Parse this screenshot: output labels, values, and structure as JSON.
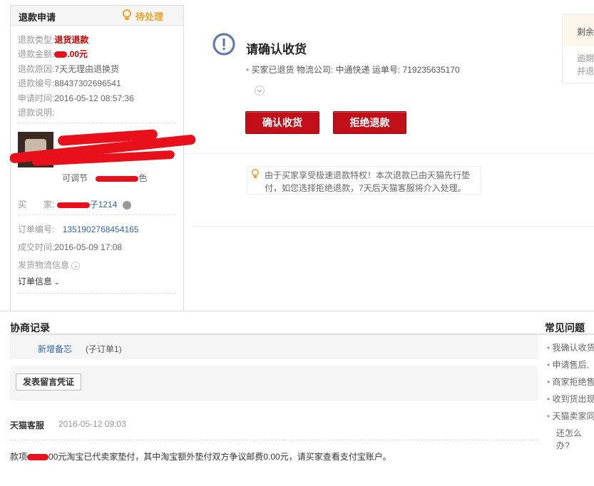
{
  "left": {
    "title": "退款申请",
    "status": "待处理",
    "fields": {
      "type_label": "退款类型:",
      "type_value": "退货退款",
      "amount_label": "退款金额:",
      "amount_value": ".00元",
      "reason_label": "退款原因:",
      "reason_value": "7天无理由退换货",
      "no_label": "退款编号:",
      "no_value": "88437302696541",
      "time_label": "申请时间:",
      "time_value": "2016-05-12 08:57:36",
      "desc_label": "退款说明:"
    },
    "product": {
      "option_label": "可调节",
      "option_suffix": "色"
    },
    "buyer_label": "买　　家:",
    "buyer_value": "子1214",
    "order_label": "订单编号:",
    "order_value": "1351902768454165",
    "deal_label": "成交时间:",
    "deal_value": "2016-05-09 17:08",
    "logistics_label": "发货物流信息",
    "order_info_label": "订单信息"
  },
  "main": {
    "title": "请确认收货",
    "ship_text": "买家已退货  物流公司: 中通快递  运单号: 719235635170",
    "confirm_btn": "确认收货",
    "reject_btn": "拒绝退款",
    "tip": "由于买家享受极速退款特权！本次退款已由天猫先行垫付，如您选择拒绝退款，7天后天猫客服将介入处理。"
  },
  "side": {
    "head": "剩余",
    "line1": "逾期",
    "line2": "并退"
  },
  "negotiation": {
    "title": "协商记录",
    "memo_link": "新增备忘",
    "memo_sub": "(子订单1)",
    "post_btn": "发表留言凭证",
    "author": "天猫客服",
    "time": "2016-05-12 09:03",
    "body_prefix": "款项",
    "body": "00元淘宝已代卖家垫付，其中淘宝额外垫付双方争议邮费0.00元，请买家查看支付宝账户。"
  },
  "faq": {
    "title": "常见问题",
    "items": [
      "我确认收货",
      "申请售后,",
      "商家拒绝售",
      "收到货出现",
      "天猫卖家同"
    ],
    "more": "还怎么办?"
  },
  "colors": {
    "accent_red": "#c2101a",
    "status_orange": "#f0a12a",
    "link_blue": "#3366aa"
  }
}
